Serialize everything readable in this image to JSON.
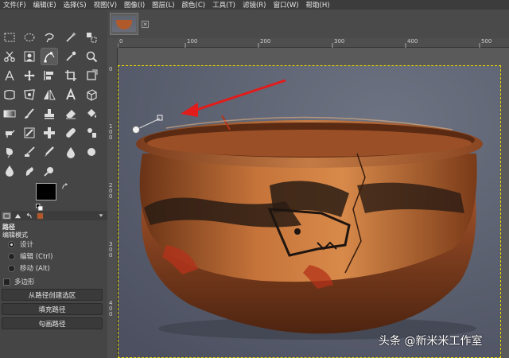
{
  "menubar": {
    "items": [
      "文件(F)",
      "编辑(E)",
      "选择(S)",
      "视图(V)",
      "图像(I)",
      "图层(L)",
      "颜色(C)",
      "工具(T)",
      "滤镜(R)",
      "窗口(W)",
      "帮助(H)"
    ]
  },
  "toolbox": {
    "active_tool": "path-tool",
    "foreground_color": "#000000",
    "background_color": "#ffffff"
  },
  "tool_options": {
    "title": "路径",
    "edit_mode_label": "编辑模式",
    "modes": [
      {
        "label": "设计",
        "selected": true
      },
      {
        "label": "编辑 (Ctrl)",
        "selected": false
      },
      {
        "label": "移动 (Alt)",
        "selected": false
      }
    ],
    "polygon_label": "多边形",
    "buttons": [
      "从路径创建选区",
      "填充路径",
      "勾画路径"
    ]
  },
  "image_tabs": {
    "close_symbol": "✕"
  },
  "rulers": {
    "top_labels": [
      "0",
      "100",
      "200",
      "300",
      "400",
      "500"
    ],
    "left_labels": [
      "0",
      "100",
      "200",
      "300",
      "400"
    ]
  },
  "canvas": {
    "selection_color": "#e5d600",
    "annotation_color": "#e21b1b"
  },
  "watermark": "头条 @新米米工作室"
}
